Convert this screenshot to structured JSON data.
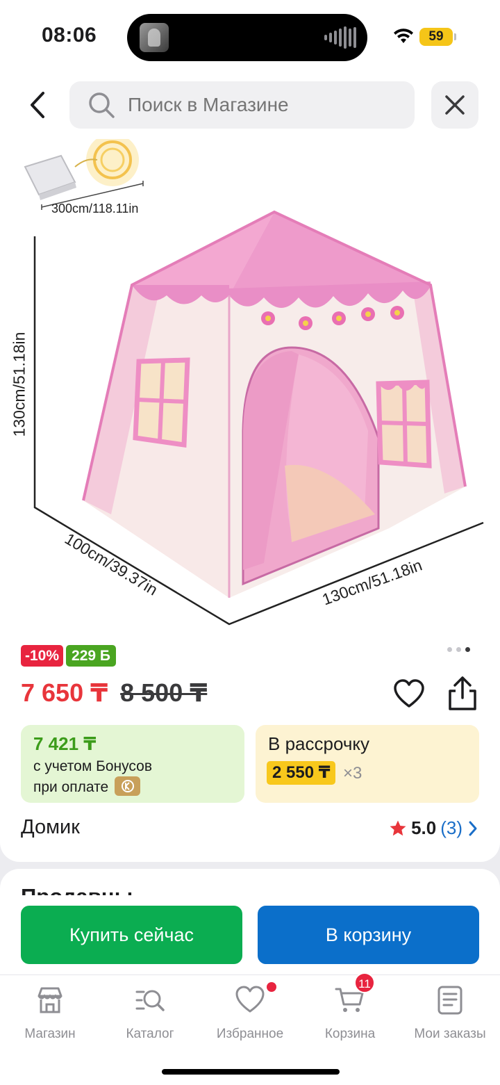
{
  "status_bar": {
    "time": "08:06",
    "battery": "59"
  },
  "search": {
    "placeholder": "Поиск в Магазине"
  },
  "product": {
    "image_labels": {
      "light_length": "300cm/118.11in",
      "height": "130cm/51.18in",
      "depth": "100cm/39.37in",
      "width": "130cm/51.18in"
    },
    "image_pages": {
      "count": 3,
      "active_index": 3
    },
    "discount_badge": "-10%",
    "bonus_badge": "229 Б",
    "price_current": "7 650 ₸",
    "price_old": "8 500 ₸",
    "bonus_offer": {
      "price": "7 421 ₸",
      "line1": "с учетом Бонусов",
      "line2": "при оплате"
    },
    "installment": {
      "title": "В рассрочку",
      "price": "2 550 ₸",
      "times": "×3"
    },
    "title": "Домик",
    "rating": {
      "value": "5.0",
      "count": "(3)"
    }
  },
  "sellers": {
    "title": "Продавцы"
  },
  "actions": {
    "buy_now": "Купить сейчас",
    "add_to_cart": "В корзину"
  },
  "tab_bar": {
    "items": [
      {
        "label": "Магазин",
        "icon": "store-icon"
      },
      {
        "label": "Каталог",
        "icon": "catalog-icon"
      },
      {
        "label": "Избранное",
        "icon": "heart-icon"
      },
      {
        "label": "Корзина",
        "icon": "cart-icon",
        "badge": "11"
      },
      {
        "label": "Мои заказы",
        "icon": "orders-icon"
      }
    ]
  },
  "colors": {
    "price_red": "#e8353b",
    "bonus_green": "#4aa521",
    "buy_green": "#0bad51",
    "cart_blue": "#0b6fca",
    "installment_yellow": "#f8c81c"
  }
}
